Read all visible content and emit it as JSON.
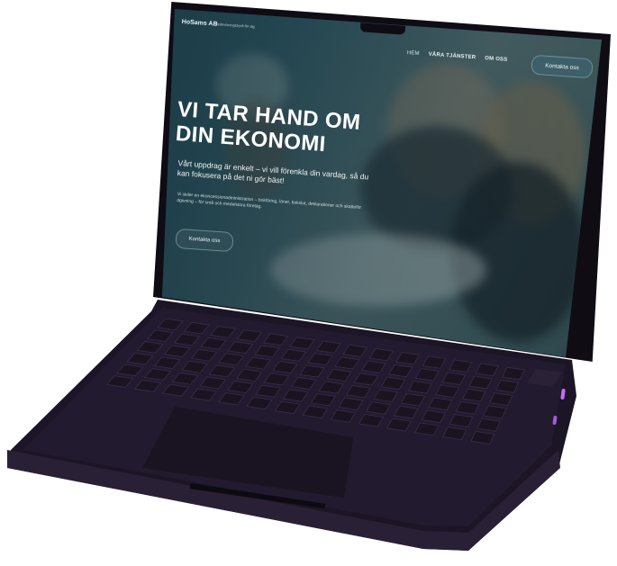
{
  "site": {
    "logo": "HoSams AB",
    "tagline": "Redovisningsbyrå för dig",
    "nav": {
      "home": "HEM",
      "services": "VÅRA TJÄNSTER",
      "about": "OM OSS"
    },
    "header_cta": "Kontakta oss",
    "hero": {
      "title": "VI TAR HAND OM DIN EKONOMI",
      "subtitle": "Vårt uppdrag är enkelt – vi vill förenkla din vardag, så du kan fokusera på det ni gör bäst!",
      "small_text": "Vi skiler en ekoncessionadministration – bokföring, löner, bokslut, deklarationer och skatteför dgivning – för små och medelstora företag.",
      "cta": "Kontakta oss"
    }
  },
  "colors": {
    "accent": "#2e4d57",
    "overlay": "#16323c",
    "device": "#1c1526",
    "port": "#c86bff"
  }
}
